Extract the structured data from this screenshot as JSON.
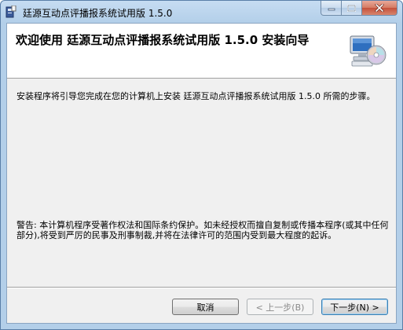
{
  "window": {
    "title": "廷源互动点评播报系统试用版 1.5.0"
  },
  "header": {
    "title": "欢迎使用 廷源互动点评播报系统试用版 1.5.0 安装向导",
    "graphic_icon": "computer-with-cd-icon"
  },
  "body": {
    "intro": "安装程序将引导您完成在您的计算机上安装 廷源互动点评播报系统试用版 1.5.0 所需的步骤。",
    "warning": "警告: 本计算机程序受著作权法和国际条约保护。如未经授权而擅自复制或传播本程序(或其中任何部分),将受到严厉的民事及刑事制裁,并将在法律许可的范围内受到最大程度的起诉。"
  },
  "buttons": {
    "cancel": "取消",
    "back": "< 上一步(B)",
    "next": "下一步(N) >"
  },
  "caption_buttons": [
    "minimize-icon",
    "maximize-icon",
    "close-icon"
  ]
}
